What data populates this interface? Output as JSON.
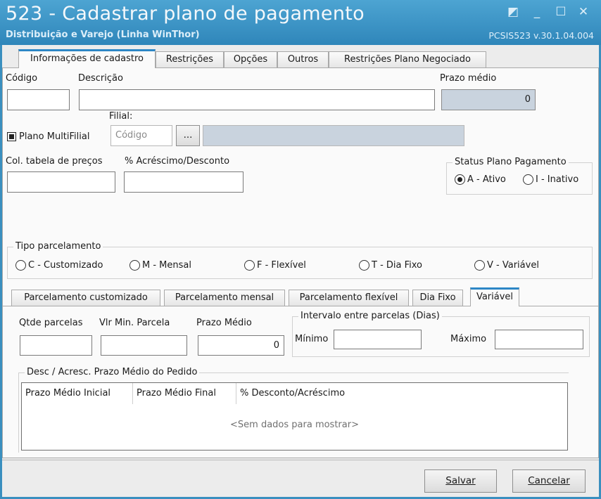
{
  "window": {
    "title": "523 - Cadastrar plano de pagamento",
    "subtitle": "Distribuição e Varejo (Linha WinThor)",
    "version": "PCSIS523  v.30.1.04.004"
  },
  "main_tabs": [
    "Informações de cadastro",
    "Restrições",
    "Opções",
    "Outros",
    "Restrições Plano Negociado"
  ],
  "cadastro": {
    "codigo_label": "Código",
    "codigo_value": "",
    "descricao_label": "Descrição",
    "descricao_value": "",
    "prazo_medio_label": "Prazo médio",
    "prazo_medio_value": "0",
    "multifilial_label": "Plano MultiFilial",
    "multifilial_checked": true,
    "filial_label": "Filial:",
    "filial_placeholder": "Código",
    "filial_browse_label": "...",
    "col_tabela_label": "Col. tabela de preços",
    "acrescimo_label": "% Acréscimo/Desconto"
  },
  "status_plano": {
    "title": "Status Plano Pagamento",
    "options": [
      "A - Ativo",
      "I - Inativo"
    ],
    "selected": "A - Ativo"
  },
  "tipo_parcelamento": {
    "title": "Tipo parcelamento",
    "options": [
      "C - Customizado",
      "M - Mensal",
      "F - Flexível",
      "T - Dia Fixo",
      "V - Variável"
    ]
  },
  "sub_tabs": [
    "Parcelamento customizado",
    "Parcelamento mensal",
    "Parcelamento flexível",
    "Dia Fixo",
    "Variável"
  ],
  "variavel": {
    "qtde_label": "Qtde parcelas",
    "vlr_min_label": "Vlr Min. Parcela",
    "prazo_medio_label": "Prazo Médio",
    "prazo_medio_value": "0",
    "intervalo_title": "Intervalo entre parcelas (Dias)",
    "minimo_label": "Mínimo",
    "maximo_label": "Máximo",
    "desc_group_title": "Desc / Acresc. Prazo Médio do Pedido",
    "grid_columns": [
      "Prazo Médio Inicial",
      "Prazo Médio Final",
      "% Desconto/Acréscimo"
    ],
    "grid_empty": "<Sem dados para mostrar>"
  },
  "buttons": {
    "salvar": "Salvar",
    "cancelar": "Cancelar"
  }
}
